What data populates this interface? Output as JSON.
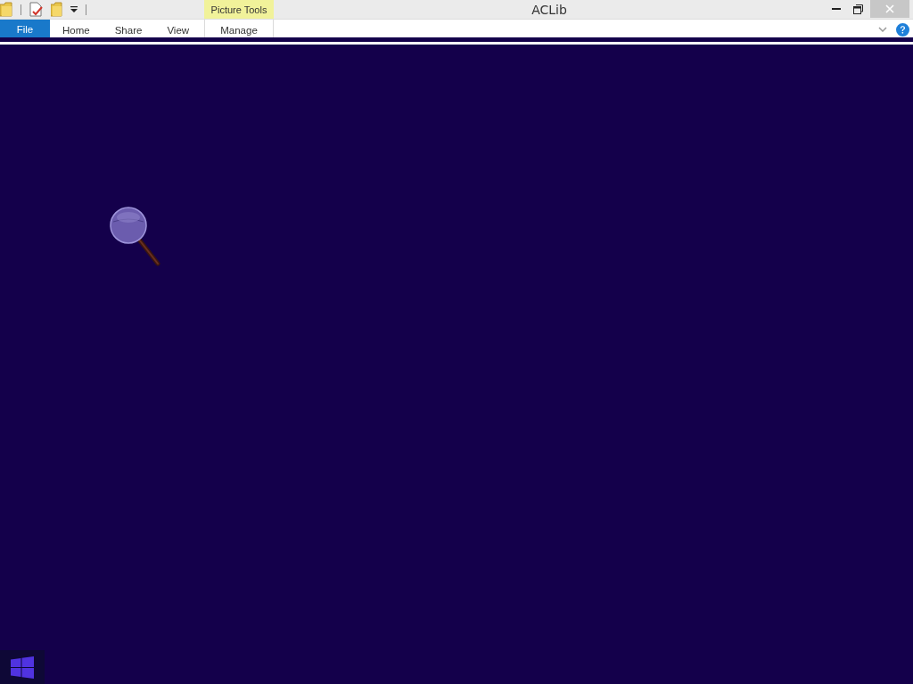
{
  "window": {
    "title": "ACLib"
  },
  "contextual_group": {
    "label": "Picture Tools"
  },
  "ribbon": {
    "tabs": [
      {
        "label": "File",
        "kind": "file"
      },
      {
        "label": "Home",
        "kind": "tab"
      },
      {
        "label": "Share",
        "kind": "tab"
      },
      {
        "label": "View",
        "kind": "tab"
      },
      {
        "label": "Manage",
        "kind": "contextual"
      }
    ]
  }
}
